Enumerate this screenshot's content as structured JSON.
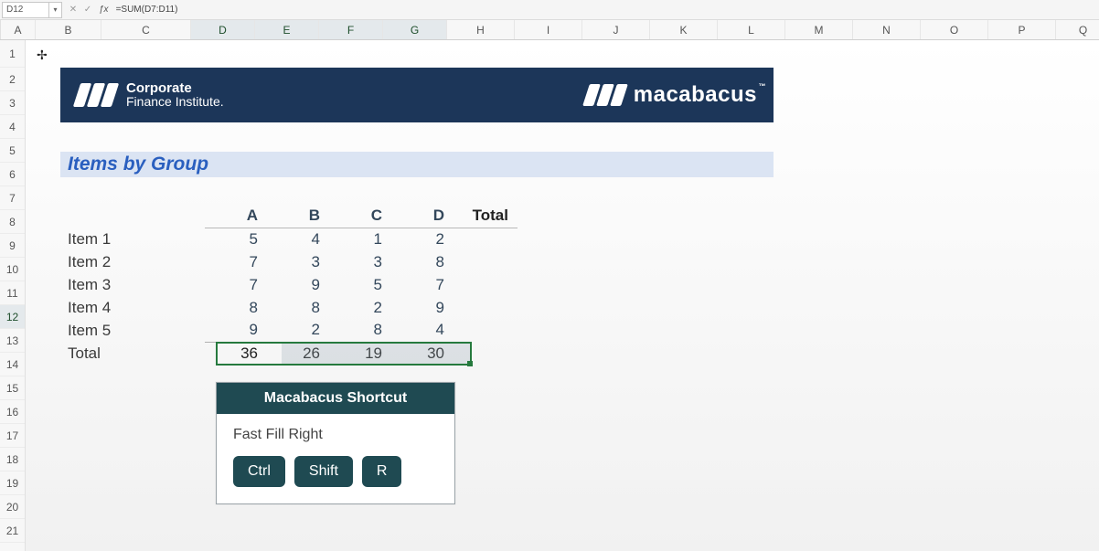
{
  "formula_bar": {
    "name_box": "D12",
    "formula": "=SUM(D7:D11)"
  },
  "columns": [
    "A",
    "B",
    "C",
    "D",
    "E",
    "F",
    "G",
    "H",
    "I",
    "J",
    "K",
    "L",
    "M",
    "N",
    "O",
    "P",
    "Q"
  ],
  "selected_cols": [
    "D",
    "E",
    "F",
    "G"
  ],
  "row_count": 21,
  "selected_row": 12,
  "banner": {
    "brand_line1": "Corporate",
    "brand_line2": "Finance Institute.",
    "right_brand": "macabacus",
    "tm": "™"
  },
  "section_title": "Items by Group",
  "chart_data": {
    "type": "table",
    "col_headers": [
      "A",
      "B",
      "C",
      "D",
      "Total"
    ],
    "rows": [
      {
        "label": "Item 1",
        "values": [
          5,
          4,
          1,
          2
        ]
      },
      {
        "label": "Item 2",
        "values": [
          7,
          3,
          3,
          8
        ]
      },
      {
        "label": "Item 3",
        "values": [
          7,
          9,
          5,
          7
        ]
      },
      {
        "label": "Item 4",
        "values": [
          8,
          8,
          2,
          9
        ]
      },
      {
        "label": "Item 5",
        "values": [
          9,
          2,
          8,
          4
        ]
      }
    ],
    "total_label": "Total",
    "col_totals": [
      36,
      26,
      19,
      30
    ]
  },
  "shortcut": {
    "title": "Macabacus Shortcut",
    "label": "Fast Fill Right",
    "keys": [
      "Ctrl",
      "Shift",
      "R"
    ]
  }
}
